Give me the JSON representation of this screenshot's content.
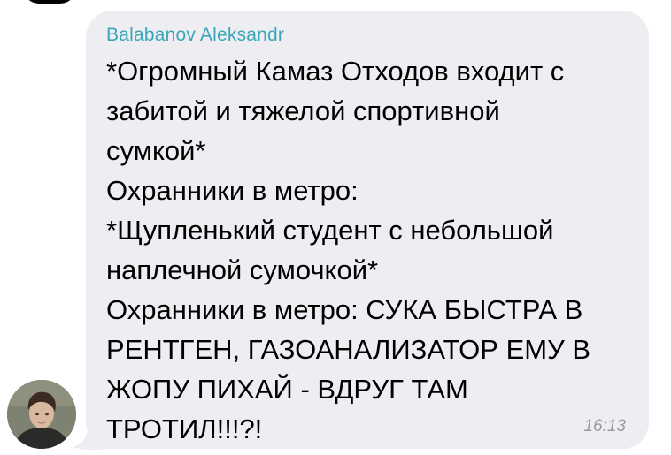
{
  "message": {
    "sender": "Balabanov Aleksandr",
    "lines": [
      "*Огромный Камаз Отходов входит с",
      "забитой и тяжелой спортивной",
      "сумкой*",
      "Охранники в метро:",
      "*Щупленький студент с небольшой",
      "наплечной сумочкой*",
      "Охранники в метро: СУКА БЫСТРА В",
      "РЕНТГЕН, ГАЗОАНАЛИЗАТОР ЕМУ В",
      "ЖОПУ ПИХАЙ - ВДРУГ ТАМ",
      "ТРОТИЛ!!!?!"
    ],
    "time": "16:13"
  },
  "colors": {
    "bubble": "#eeeef2",
    "sender": "#3aa7b8",
    "time": "#9a9aa2"
  },
  "icons": {
    "avatar": "user-avatar-photo"
  }
}
